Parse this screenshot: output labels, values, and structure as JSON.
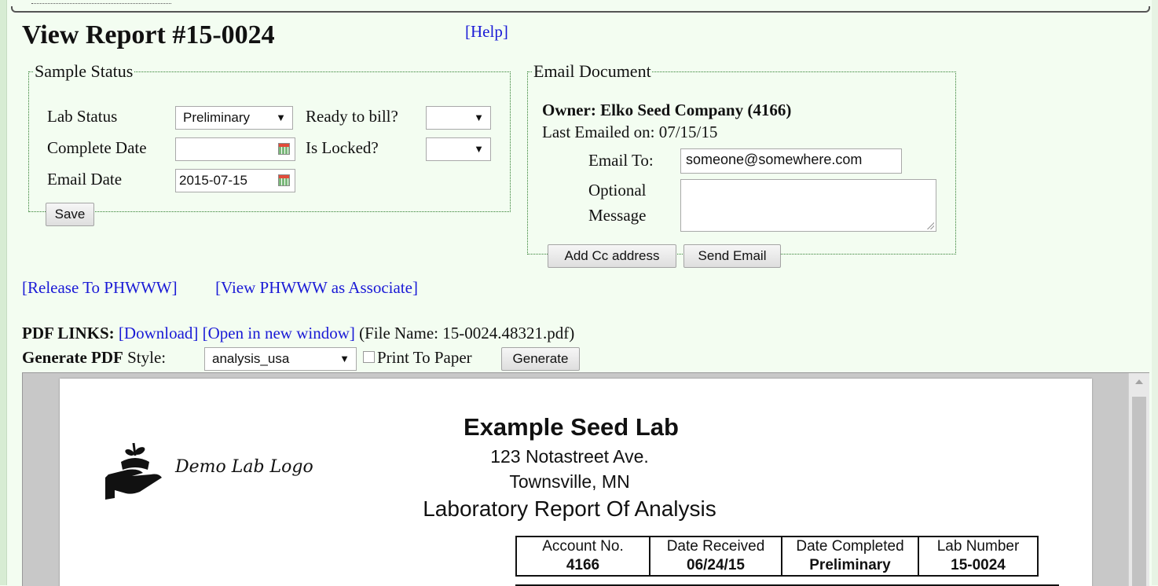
{
  "page": {
    "title": "View Report #15-0024",
    "help_link": "[Help]"
  },
  "sample_status": {
    "legend": "Sample Status",
    "lab_status_label": "Lab Status",
    "lab_status_value": "Preliminary",
    "ready_to_bill_label": "Ready to bill?",
    "ready_to_bill_value": "",
    "complete_date_label": "Complete Date",
    "complete_date_value": "",
    "is_locked_label": "Is Locked?",
    "is_locked_value": "",
    "email_date_label": "Email Date",
    "email_date_value": "2015-07-15",
    "save_label": "Save"
  },
  "email_document": {
    "legend": "Email Document",
    "owner": "Owner: Elko Seed Company (4166)",
    "last_emailed_label": "Last Emailed on:",
    "last_emailed_value": "07/15/15",
    "email_to_label": "Email To:",
    "email_to_value": "someone@somewhere.com",
    "optional_label_1": "Optional",
    "optional_label_2": "Message",
    "optional_message_value": "",
    "add_cc_label": "Add Cc address",
    "send_label": "Send Email"
  },
  "release_links": {
    "release": "[Release To PHWWW]",
    "view_associate": "[View PHWWW as Associate]"
  },
  "pdf_links": {
    "label": "PDF LINKS:",
    "download": "[Download]",
    "open_new_window": "[Open in new window]",
    "file_name": "(File Name: 15-0024.48321.pdf)"
  },
  "generate_pdf": {
    "label": "Generate PDF",
    "style_label": "Style:",
    "style_value": "analysis_usa",
    "print_to_paper_label": "Print To Paper",
    "print_to_paper_checked": false,
    "generate_button": "Generate"
  },
  "pdf_preview": {
    "logo_text": "Demo Lab Logo",
    "lab_name": "Example Seed Lab",
    "address_1": "123 Notastreet Ave.",
    "address_2": "Townsville, MN",
    "report_title": "Laboratory Report Of Analysis",
    "table": {
      "headers": [
        "Account No.",
        "Date Received",
        "Date Completed",
        "Lab Number"
      ],
      "values": [
        "4166",
        "06/24/15",
        "Preliminary",
        "15-0024"
      ]
    }
  },
  "icons": [
    "calendar-icon",
    "dropdown-arrow-icon",
    "plant-in-hand-icon",
    "scroll-up-arrow-icon"
  ]
}
